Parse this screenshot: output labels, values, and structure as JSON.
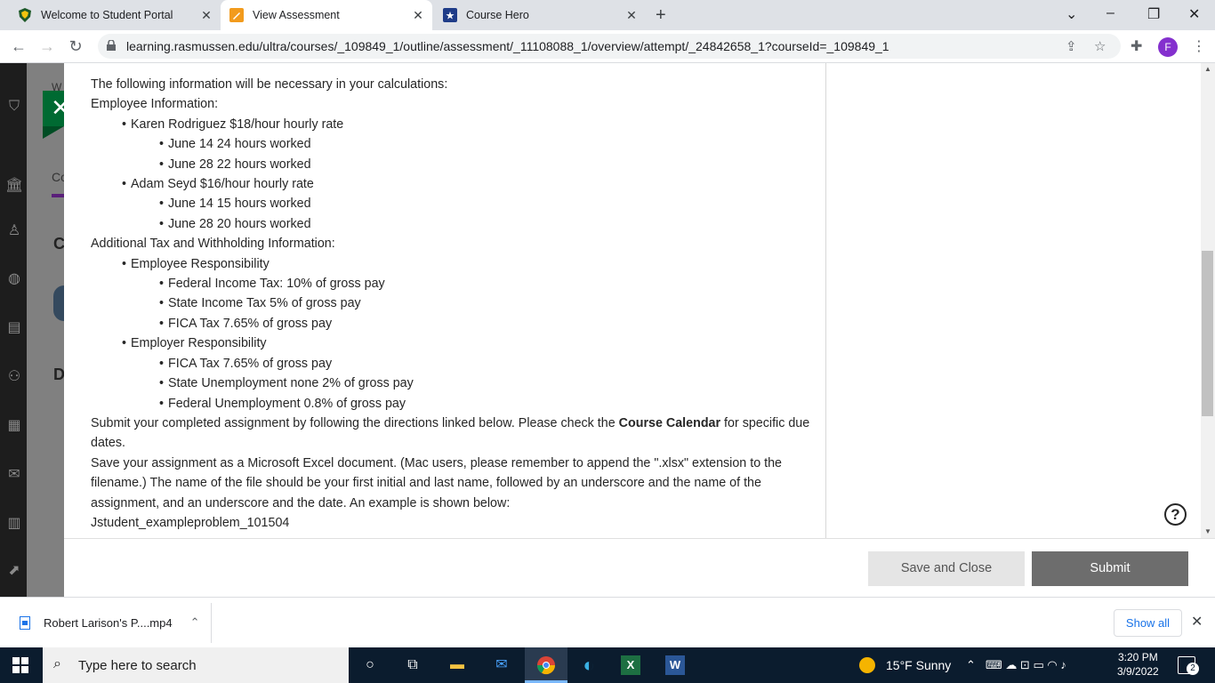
{
  "tabs": [
    {
      "title": "Welcome to Student Portal"
    },
    {
      "title": "View Assessment"
    },
    {
      "title": "Course Hero"
    }
  ],
  "address_bar": {
    "url": "learning.rasmussen.edu/ultra/courses/_109849_1/outline/assessment/_11108088_1/overview/attempt/_24842658_1?courseId=_109849_1"
  },
  "profile": {
    "initial": "F"
  },
  "background_nav_fragments": {
    "a": "W",
    "b": "Co",
    "c": "C",
    "d": "D"
  },
  "content": {
    "intro": "The following information will be necessary in your calculations:",
    "emp_heading": "Employee Information:",
    "karen": "Karen Rodriguez $18/hour hourly rate",
    "karen_j14": "June 14 24 hours worked",
    "karen_j28": "June 28 22 hours worked",
    "adam": "Adam Seyd $16/hour hourly rate",
    "adam_j14": "June 14 15 hours worked",
    "adam_j28": "June 28 20 hours worked",
    "tax_heading": "Additional Tax and Withholding Information:",
    "employee_resp": "Employee Responsibility",
    "fed_income": "Federal Income Tax: 10% of gross pay",
    "state_income": "State Income Tax 5% of gross pay",
    "fica_emp": "FICA Tax 7.65% of gross pay",
    "employer_resp": "Employer Responsibility",
    "fica_er": "FICA Tax 7.65% of gross pay",
    "state_unemp": "State Unemployment none 2% of gross pay",
    "fed_unemp": "Federal Unemployment 0.8% of gross pay",
    "submit_p1": "Submit your completed assignment by following the directions linked below. Please check the ",
    "submit_bold": "Course Calendar",
    "submit_p2": " for specific due dates.",
    "save_text": "Save your assignment as a Microsoft Excel document. (Mac users, please remember to append the \".xlsx\" extension to the filename.) The name of the file should be your first initial and last name, followed by an underscore and the name of the assignment, and an underscore and the date. An example is shown below:",
    "example": "Jstudent_exampleproblem_101504"
  },
  "buttons": {
    "save_close": "Save and Close",
    "submit": "Submit"
  },
  "download": {
    "file": "Robert Larison's P....mp4",
    "show_all": "Show all"
  },
  "taskbar": {
    "search_placeholder": "Type here to search",
    "weather": "15°F  Sunny",
    "time": "3:20 PM",
    "date": "3/9/2022",
    "notifications": "2"
  }
}
